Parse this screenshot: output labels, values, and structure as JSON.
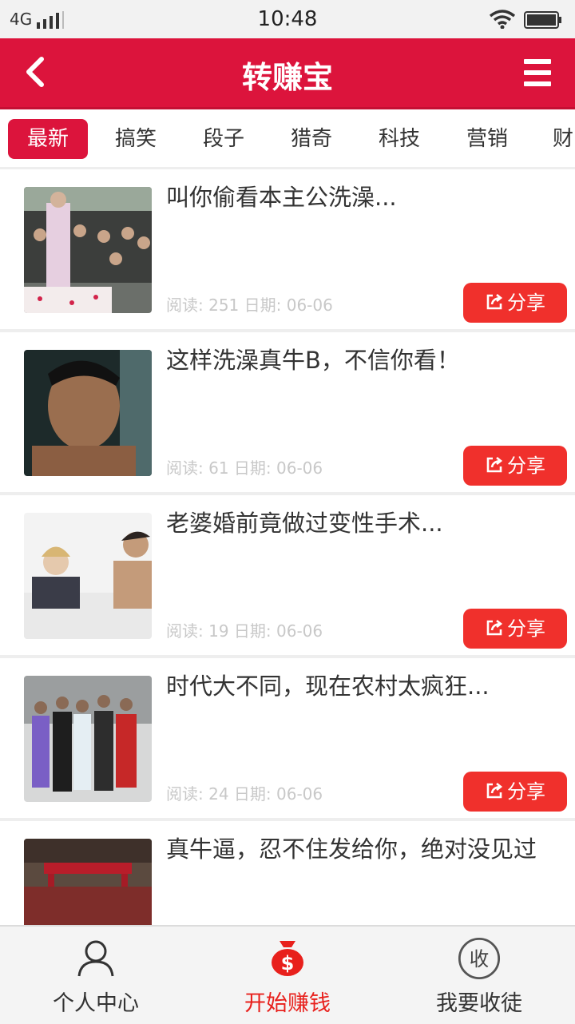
{
  "status_bar": {
    "network": "4G",
    "time": "10:48"
  },
  "app_bar": {
    "title": "转赚宝",
    "back_icon": "back-chevron-icon",
    "menu_icon": "hamburger-menu-icon"
  },
  "tabs": [
    {
      "label": "最新",
      "active": true
    },
    {
      "label": "搞笑",
      "active": false
    },
    {
      "label": "段子",
      "active": false
    },
    {
      "label": "猎奇",
      "active": false
    },
    {
      "label": "科技",
      "active": false
    },
    {
      "label": "营销",
      "active": false
    },
    {
      "label": "财",
      "active": false
    }
  ],
  "articles": [
    {
      "title": "叫你偷看本主公洗澡...",
      "meta": "阅读: 251 日期: 06-06",
      "share_label": "分享"
    },
    {
      "title": "这样洗澡真牛B，不信你看！",
      "meta": "阅读: 61 日期: 06-06",
      "share_label": "分享"
    },
    {
      "title": "老婆婚前竟做过变性手术...",
      "meta": "阅读: 19 日期: 06-06",
      "share_label": "分享"
    },
    {
      "title": "时代大不同，现在农村太疯狂...",
      "meta": "阅读: 24 日期: 06-06",
      "share_label": "分享"
    },
    {
      "title": "真牛逼，忍不住发给你，绝对没见过"
    }
  ],
  "bottom_nav": [
    {
      "label": "个人中心",
      "icon": "person-icon",
      "active": false
    },
    {
      "label": "开始赚钱",
      "icon": "money-bag-icon",
      "active": true
    },
    {
      "label": "我要收徒",
      "icon": "shou-circle-icon",
      "icon_text": "收",
      "active": false
    }
  ],
  "colors": {
    "accent": "#dc143c",
    "share_button": "#f0302c",
    "active_nav": "#e8201c"
  }
}
